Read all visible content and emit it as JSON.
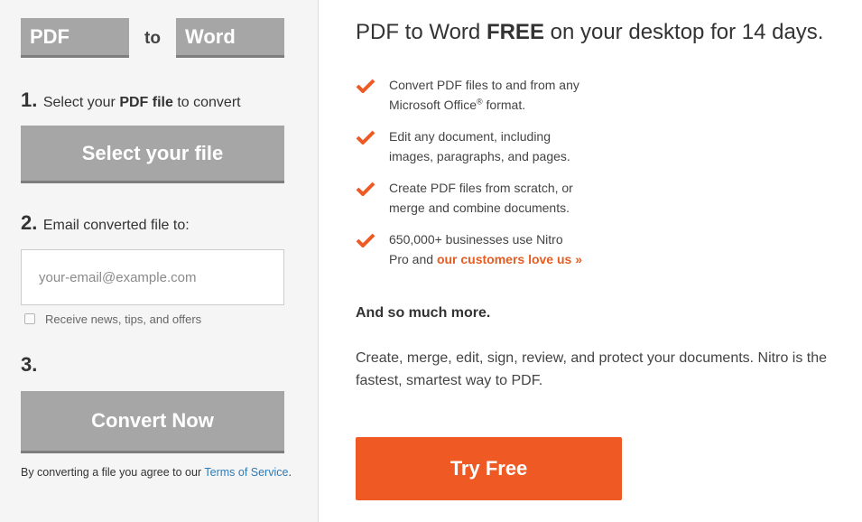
{
  "converter": {
    "from_format": "PDF",
    "connector": "to",
    "to_format": "Word",
    "step1": {
      "number": "1.",
      "text_before": "Select your",
      "text_bold": "PDF file",
      "text_after": "to convert"
    },
    "select_button": "Select your file",
    "step2": {
      "number": "2.",
      "text": "Email converted file to:"
    },
    "email_placeholder": "your-email@example.com",
    "newsletter_label": "Receive news, tips, and offers",
    "step3": {
      "number": "3."
    },
    "convert_button": "Convert Now",
    "terms_prefix": "By converting a file you agree to our",
    "terms_link": "Terms of Service",
    "terms_suffix": "."
  },
  "promo": {
    "headline_before": "PDF to Word",
    "headline_bold": "FREE",
    "headline_after": "on your desktop for 14 days.",
    "features": [
      {
        "line1": "Convert PDF files to and from any",
        "line2_before": "Microsoft Office",
        "line2_sup": "®",
        "line2_after": "format."
      },
      {
        "line1": "Edit any document, including",
        "line2": "images, paragraphs, and pages."
      },
      {
        "line1": "Create PDF files from scratch, or",
        "line2": "merge and combine documents."
      },
      {
        "line1": "650,000+ businesses use Nitro",
        "line2_before": "Pro and",
        "line2_link": "our customers love us »"
      }
    ],
    "more_title": "And so much more.",
    "more_desc": "Create, merge, edit, sign, review, and protect your documents. Nitro is the fastest, smartest way to PDF.",
    "try_button": "Try Free"
  },
  "colors": {
    "accent": "#ef5a24",
    "button_gray": "#a6a6a6",
    "link_blue": "#2e7bb5"
  }
}
